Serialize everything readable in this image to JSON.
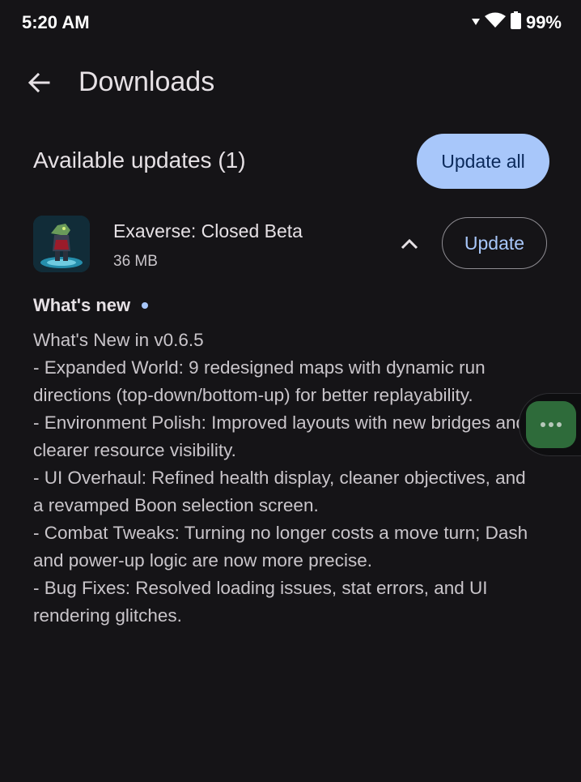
{
  "status_bar": {
    "time": "5:20 AM",
    "battery": "99%",
    "icons": [
      "signal-icon",
      "wifi-icon",
      "battery-icon"
    ]
  },
  "app_bar": {
    "back_icon": "arrow-left-icon",
    "title": "Downloads"
  },
  "updates": {
    "title": "Available updates (1)",
    "update_all_label": "Update all",
    "items": [
      {
        "name": "Exaverse: Closed Beta",
        "size": "36 MB",
        "update_label": "Update",
        "expanded": true,
        "icon": "exaverse-app-icon"
      }
    ]
  },
  "whats_new": {
    "title": "What's new",
    "lines": [
      "What's New in v0.6.5",
      "- Expanded World: 9 redesigned maps with dynamic run",
      "directions (top-down/bottom-up) for better replayability.",
      "- Environment Polish: Improved layouts with new bridges and",
      "clearer resource visibility.",
      "- UI Overhaul: Refined health display, cleaner objectives, and",
      "a revamped Boon selection screen.",
      "- Combat Tweaks: Turning no longer costs a move turn; Dash",
      "and power-up logic are now more precise.",
      "- Bug Fixes: Resolved loading issues, stat errors, and UI",
      "rendering glitches."
    ]
  },
  "colors": {
    "background": "#151417",
    "accent": "#a8c7fa",
    "bubble": "#2e6b3a"
  }
}
